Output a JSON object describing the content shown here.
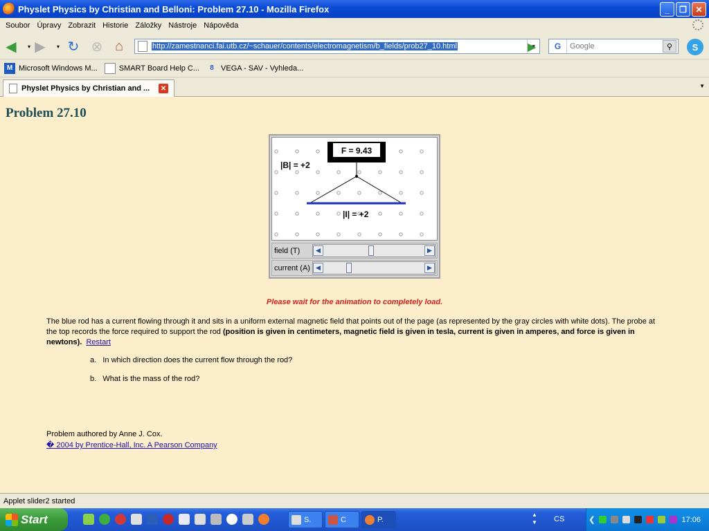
{
  "window": {
    "title": "Physlet Physics by Christian and Belloni: Problem 27.10 - Mozilla Firefox",
    "controls": [
      "_",
      "❐",
      "✕"
    ]
  },
  "menu": [
    "Soubor",
    "Úpravy",
    "Zobrazit",
    "Historie",
    "Záložky",
    "Nástroje",
    "Nápověda"
  ],
  "nav": {
    "url": "http://zamestnanci.fai.utb.cz/~schauer/contents/electromagnetism/b_fields/prob27_10.html",
    "search_engine": "G",
    "search_placeholder": "Google",
    "icons": [
      "back-icon",
      "forward-icon",
      "reload-icon",
      "stop-icon",
      "home-icon",
      "go-icon",
      "search-icon",
      "skype-icon"
    ]
  },
  "bookmarks": [
    {
      "label": "Microsoft Windows M...",
      "icon": "M"
    },
    {
      "label": "SMART Board Help C...",
      "icon": ""
    },
    {
      "label": "VEGA - SAV - Vyhleda...",
      "icon": "8"
    }
  ],
  "tab": {
    "label": "Physlet Physics by Christian and ..."
  },
  "page": {
    "title": "Problem 27.10",
    "applet": {
      "force_label": "F = 9.43",
      "field_label": "|B| = +2",
      "current_label": "|I| = +2",
      "sliders": [
        {
          "label": "field (T)",
          "position": 0.47
        },
        {
          "label": "current (A)",
          "position": 0.23
        }
      ]
    },
    "wait_message": "Please wait for the animation to completely load.",
    "desc_plain": "The blue rod has a current flowing through it and sits in a uniform external magnetic field that points out of the page (as represented by the gray circles with white dots).  The probe at the top records the force required to support the rod ",
    "desc_bold": "(position is given in centimeters, magnetic field is given in tesla, current is given in amperes, and force is given in newtons).",
    "restart_label": "Restart",
    "questions": [
      {
        "letter": "a.",
        "text": "In which direction does the current flow through the rod?"
      },
      {
        "letter": "b.",
        "text": "What is the mass of the rod?"
      }
    ],
    "author": "Problem authored by Anne J. Cox.",
    "copyright": "� 2004 by Prentice-Hall, Inc. A Pearson Company"
  },
  "status": "Applet slider2 started",
  "taskbar": {
    "start_label": "Start",
    "tasks": [
      {
        "label": "S."
      },
      {
        "label": "C"
      },
      {
        "label": "P."
      }
    ],
    "language": "CS",
    "clock": "17:06"
  }
}
